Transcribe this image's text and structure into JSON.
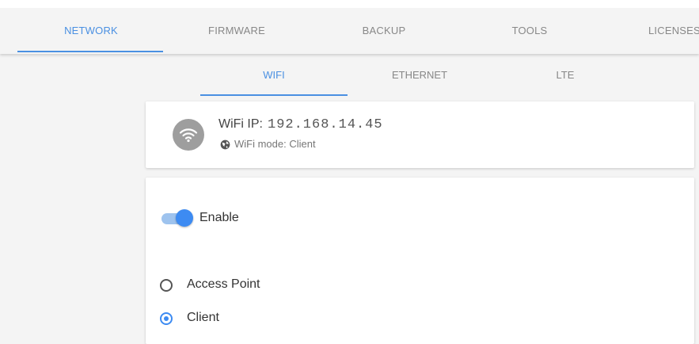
{
  "nav": {
    "tabs": [
      {
        "label": "NETWORK",
        "active": true
      },
      {
        "label": "FIRMWARE",
        "active": false
      },
      {
        "label": "BACKUP",
        "active": false
      },
      {
        "label": "TOOLS",
        "active": false
      },
      {
        "label": "LICENSES",
        "active": false
      }
    ]
  },
  "subnav": {
    "tabs": [
      {
        "label": "WIFI",
        "active": true
      },
      {
        "label": "ETHERNET",
        "active": false
      },
      {
        "label": "LTE",
        "active": false
      }
    ]
  },
  "status": {
    "icon": "wifi-icon",
    "ip_label": "WiFi IP:",
    "ip_value": "192.168.14.45",
    "mode_icon": "globe-icon",
    "mode_text": "WiFi mode: Client"
  },
  "settings": {
    "enable_label": "Enable",
    "enabled": true,
    "mode_options": [
      {
        "label": "Access Point",
        "selected": false
      },
      {
        "label": "Client",
        "selected": true
      }
    ]
  },
  "colors": {
    "accent": "#4a90e2",
    "toggle_on": "#3d8bf2",
    "background": "#f4f4f4"
  }
}
